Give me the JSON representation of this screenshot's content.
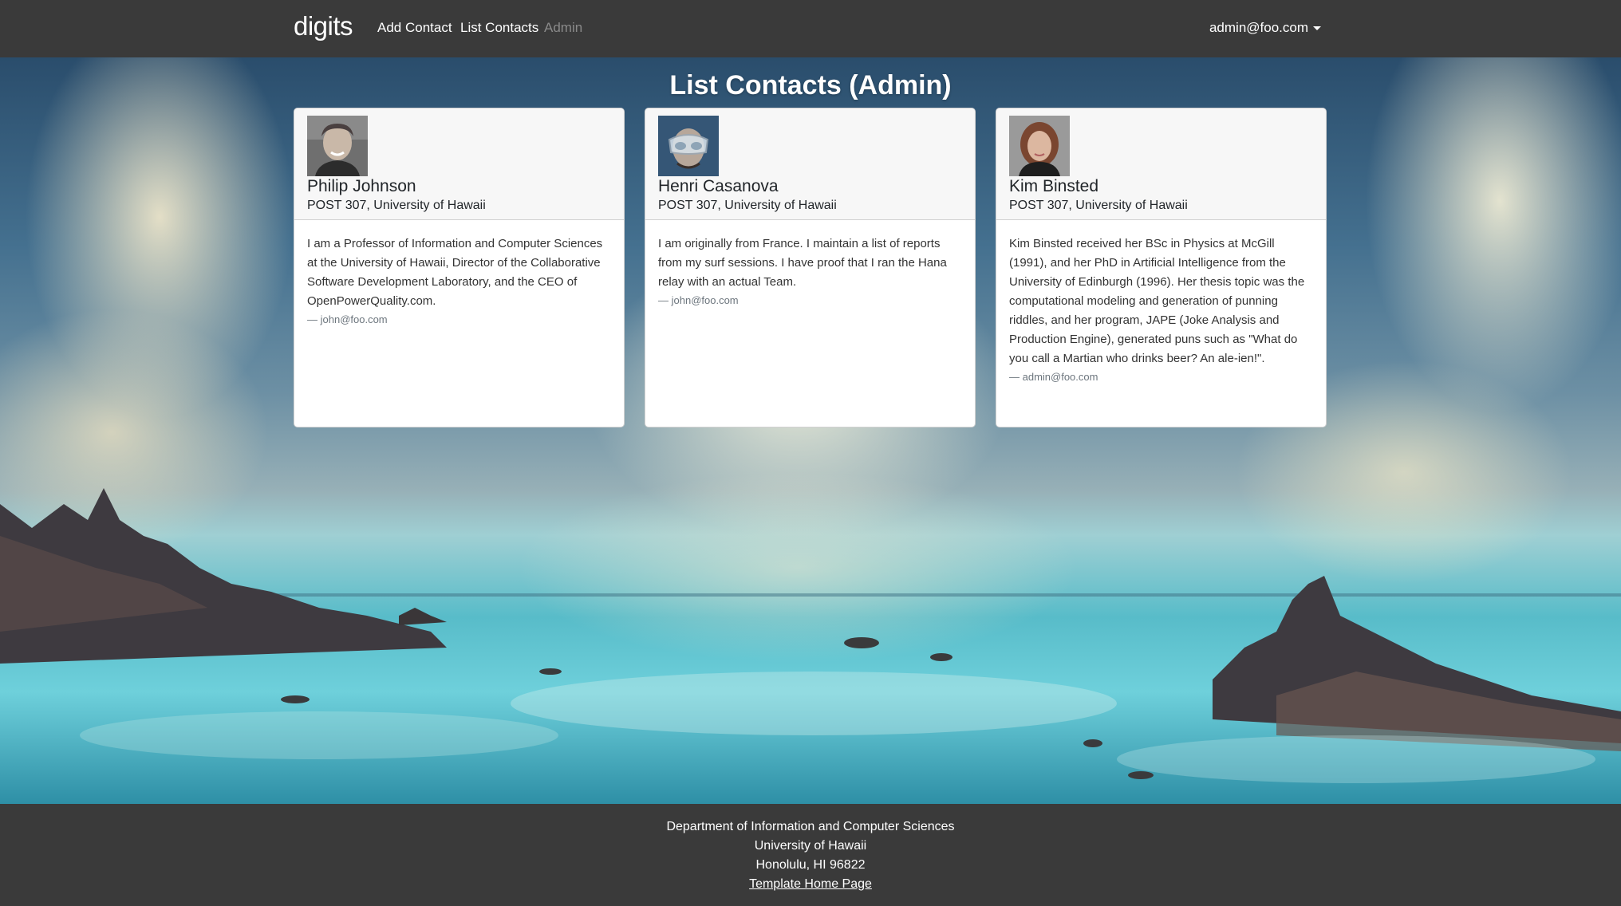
{
  "navbar": {
    "brand": "digits",
    "links": {
      "add_contact": "Add Contact",
      "list_contacts": "List Contacts",
      "admin": "Admin"
    },
    "user": "admin@foo.com"
  },
  "page": {
    "title": "List Contacts (Admin)"
  },
  "contacts": [
    {
      "name": "Philip Johnson",
      "address": "POST 307, University of Hawaii",
      "description": "I am a Professor of Information and Computer Sciences at the University of Hawaii, Director of the Collaborative Software Development Laboratory, and the CEO of OpenPowerQuality.com.",
      "owner": "— john@foo.com"
    },
    {
      "name": "Henri Casanova",
      "address": "POST 307, University of Hawaii",
      "description": "I am originally from France. I maintain a list of reports from my surf sessions. I have proof that I ran the Hana relay with an actual Team.",
      "owner": "— john@foo.com"
    },
    {
      "name": "Kim Binsted",
      "address": "POST 307, University of Hawaii",
      "description": "Kim Binsted received her BSc in Physics at McGill (1991), and her PhD in Artificial Intelligence from the University of Edinburgh (1996). Her thesis topic was the computational modeling and generation of punning riddles, and her program, JAPE (Joke Analysis and Production Engine), generated puns such as \"What do you call a Martian who drinks beer? An ale-ien!\".",
      "owner": "— admin@foo.com"
    }
  ],
  "footer": {
    "line1": "Department of Information and Computer Sciences",
    "line2": "University of Hawaii",
    "line3": "Honolulu, HI 96822",
    "link": "Template Home Page"
  }
}
